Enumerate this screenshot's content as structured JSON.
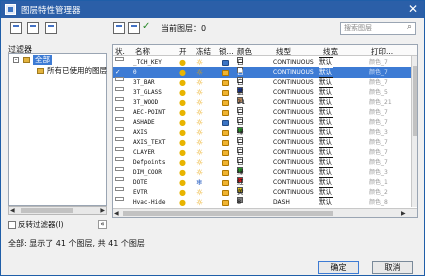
{
  "window": {
    "title": "图层特性管理器",
    "close_glyph": "✕"
  },
  "toolbar": {
    "current_layer_label": "当前图层：0",
    "search_placeholder": "搜索图层"
  },
  "filters": {
    "label": "过滤器",
    "tree": [
      {
        "label": "全部",
        "selected": true
      },
      {
        "label": "所有已使用的图层",
        "selected": false
      }
    ],
    "invert_label": "反转过滤器(I)",
    "collapse_glyph": "«"
  },
  "grid": {
    "columns": [
      "状.",
      "名称",
      "开",
      "冻结",
      "锁...",
      "颜色",
      "线型",
      "线宽",
      "打印..."
    ],
    "rows": [
      {
        "name": "_TCH_KEY",
        "on": true,
        "frozen": false,
        "locked": true,
        "color_name": "白",
        "color_hex": "#ffffff",
        "linetype": "CONTINUOUS",
        "lineweight": "默认",
        "plot_style": "颜色_7",
        "selected": false,
        "current": false
      },
      {
        "name": "0",
        "on": true,
        "frozen": false,
        "locked": false,
        "color_name": "白",
        "color_hex": "#ffffff",
        "linetype": "CONTINUOUS",
        "lineweight": "默认",
        "plot_style": "颜色_7",
        "selected": true,
        "current": true
      },
      {
        "name": "3T_BAR",
        "on": true,
        "frozen": false,
        "locked": false,
        "color_name": "白",
        "color_hex": "#ffffff",
        "linetype": "CONTINUOUS",
        "lineweight": "默认",
        "plot_style": "颜色_7",
        "selected": false,
        "current": false
      },
      {
        "name": "3T_GLASS",
        "on": true,
        "frozen": false,
        "locked": false,
        "color_name": "蓝",
        "color_hex": "#1f3fa8",
        "linetype": "CONTINUOUS",
        "lineweight": "默认",
        "plot_style": "颜色_5",
        "selected": false,
        "current": false
      },
      {
        "name": "3T_WOOD",
        "on": true,
        "frozen": false,
        "locked": false,
        "color_name": "21",
        "color_hex": "#b5865c",
        "linetype": "CONTINUOUS",
        "lineweight": "默认",
        "plot_style": "颜色_21",
        "selected": false,
        "current": false
      },
      {
        "name": "AEC-POINT",
        "on": true,
        "frozen": false,
        "locked": false,
        "color_name": "白",
        "color_hex": "#ffffff",
        "linetype": "CONTINUOUS",
        "lineweight": "默认",
        "plot_style": "颜色_7",
        "selected": false,
        "current": false
      },
      {
        "name": "ASHADE",
        "on": true,
        "frozen": false,
        "locked": true,
        "color_name": "白",
        "color_hex": "#ffffff",
        "linetype": "CONTINUOUS",
        "lineweight": "默认",
        "plot_style": "颜色_7",
        "selected": false,
        "current": false
      },
      {
        "name": "AXIS",
        "on": true,
        "frozen": false,
        "locked": false,
        "color_name": "绿",
        "color_hex": "#2da02d",
        "linetype": "CONTINUOUS",
        "lineweight": "默认",
        "plot_style": "颜色_3",
        "selected": false,
        "current": false
      },
      {
        "name": "AXIS_TEXT",
        "on": true,
        "frozen": false,
        "locked": false,
        "color_name": "白",
        "color_hex": "#ffffff",
        "linetype": "CONTINUOUS",
        "lineweight": "默认",
        "plot_style": "颜色_7",
        "selected": false,
        "current": false
      },
      {
        "name": "CLAYER",
        "on": true,
        "frozen": false,
        "locked": false,
        "color_name": "白",
        "color_hex": "#ffffff",
        "linetype": "CONTINUOUS",
        "lineweight": "默认",
        "plot_style": "颜色_7",
        "selected": false,
        "current": false
      },
      {
        "name": "Defpoints",
        "on": true,
        "frozen": false,
        "locked": false,
        "color_name": "白",
        "color_hex": "#ffffff",
        "linetype": "CONTINUOUS",
        "lineweight": "默认",
        "plot_style": "颜色_7",
        "selected": false,
        "current": false
      },
      {
        "name": "DIM_COOR",
        "on": true,
        "frozen": false,
        "locked": false,
        "color_name": "绿",
        "color_hex": "#2da02d",
        "linetype": "CONTINUOUS",
        "lineweight": "默认",
        "plot_style": "颜色_3",
        "selected": false,
        "current": false
      },
      {
        "name": "DOTE",
        "on": true,
        "frozen": true,
        "locked": false,
        "color_name": "红",
        "color_hex": "#d42020",
        "linetype": "CONTINUOUS",
        "lineweight": "默认",
        "plot_style": "颜色_1",
        "selected": false,
        "current": false
      },
      {
        "name": "EVTR",
        "on": true,
        "frozen": false,
        "locked": false,
        "color_name": "黄",
        "color_hex": "#f2d21b",
        "linetype": "CONTINUOUS",
        "lineweight": "默认",
        "plot_style": "颜色_2",
        "selected": false,
        "current": false
      },
      {
        "name": "Hvac-Hide",
        "on": true,
        "frozen": false,
        "locked": false,
        "color_name": "8",
        "color_hex": "#808080",
        "linetype": "DASH",
        "lineweight": "默认",
        "plot_style": "颜色_8",
        "selected": false,
        "current": false
      }
    ]
  },
  "status_text": "全部: 显示了 41 个图层, 共 41 个图层",
  "buttons": {
    "ok": "确定",
    "cancel": "取消"
  },
  "icons": {
    "new_filter": "new-property-filter-icon",
    "new_group": "new-group-filter-icon",
    "state_manager": "layer-states-manager-icon",
    "new_layer": "new-layer-icon",
    "delete_layer": "delete-layer-icon",
    "set_current": "set-current-icon",
    "search": "search-icon"
  },
  "colors": {
    "accent": "#3d7bd4",
    "titlebar": "#2b5fa8"
  }
}
